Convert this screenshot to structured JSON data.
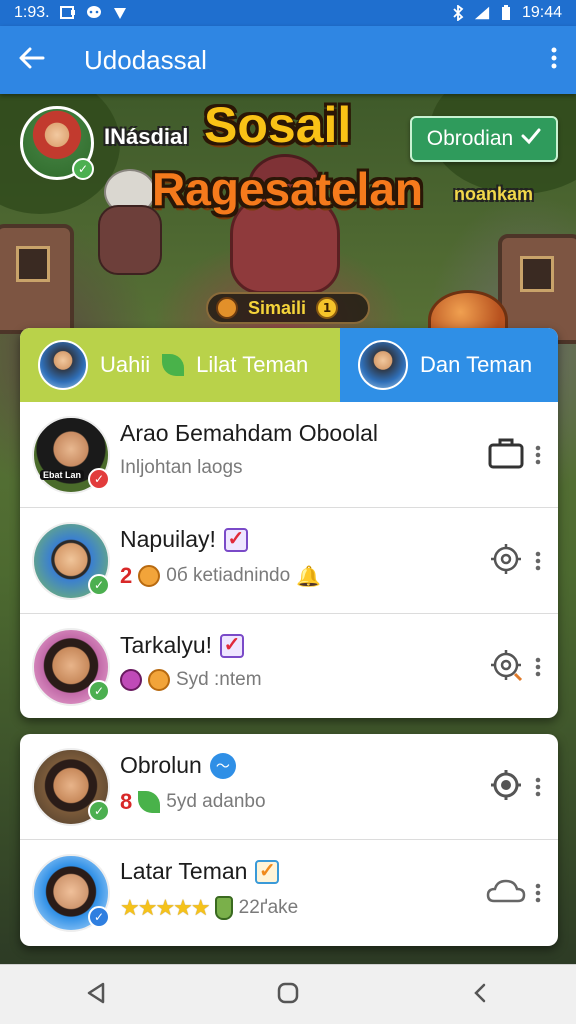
{
  "status_bar": {
    "time_left": "1:93.",
    "time_right": "19:44",
    "icons": [
      "notification-icon",
      "chat-bubble-icon",
      "shield-icon",
      "bluetooth-icon",
      "signal-icon",
      "battery-icon"
    ]
  },
  "app_bar": {
    "title": "Udodassal",
    "back_icon": "arrow-left-icon",
    "menu_icon": "more-vert-icon"
  },
  "banner": {
    "subtitle": "INásdial",
    "title_line1": "Sosail",
    "title_line2": "Ragesatelan",
    "tagline": "noankam",
    "join_label": "Obrodian",
    "level_label": "Simaili",
    "level_coin": "1"
  },
  "tabs": [
    {
      "label": "Uahii",
      "label2": "Lilat Teman"
    },
    {
      "label": "Dan Teman"
    }
  ],
  "friends": [
    {
      "name": "Arao Бemahdam Oboolal",
      "sub": "Inljohtan laogs",
      "avatar_caption": "Ebat Lan",
      "action_icon": "briefcase-icon"
    },
    {
      "name": "Napuilay!",
      "sub": "0б ketiadnindo",
      "num": "2",
      "action_icon": "gear-icon"
    },
    {
      "name": "Tarkalyu!",
      "sub": "Syd :ntem",
      "action_icon": "gear-icon"
    }
  ],
  "friends_bottom": [
    {
      "name": "Obrolun",
      "sub": "5yd adanbo",
      "num": "8",
      "action_icon": "gear-icon"
    },
    {
      "name": "Latar Teman",
      "sub": "22ґake",
      "stars": "★★★★★",
      "action_icon": "cloud-icon"
    }
  ],
  "nav": {
    "back_icon": "nav-back-icon",
    "home_icon": "nav-home-icon",
    "recent_icon": "nav-recents-icon"
  },
  "colors": {
    "app_bar": "#2f86e3",
    "tab_active": "#b9d24a",
    "tab_other": "#2f8fe6",
    "join_button": "#2f9b5c"
  }
}
